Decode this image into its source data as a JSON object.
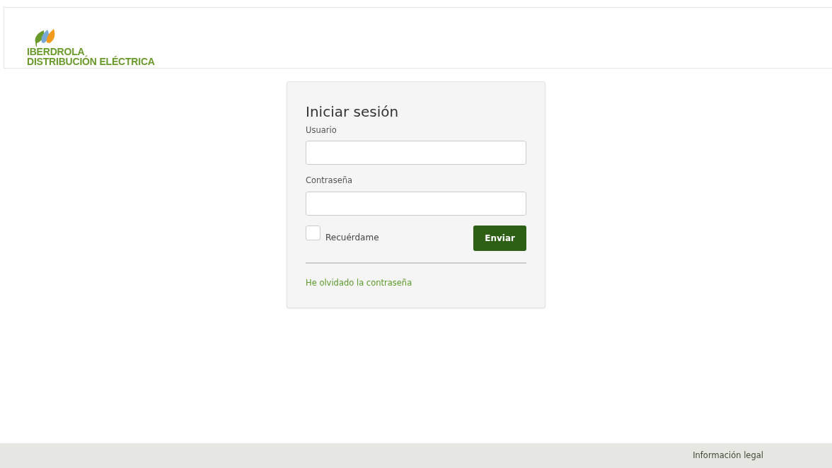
{
  "header": {
    "logo_lines": [
      "IBERDROLA",
      "DISTRIBUCIÓN ELÉCTRICA"
    ]
  },
  "login": {
    "title": "Iniciar sesión",
    "fields": [
      {
        "label": "Usuario"
      },
      {
        "label": "Contraseña"
      }
    ],
    "remember": {
      "label": "Recuérdame",
      "checked": false
    },
    "submit": "Enviar",
    "forgot_link": "He olvidado la contraseña"
  },
  "footer": {
    "link": "Información legal"
  }
}
